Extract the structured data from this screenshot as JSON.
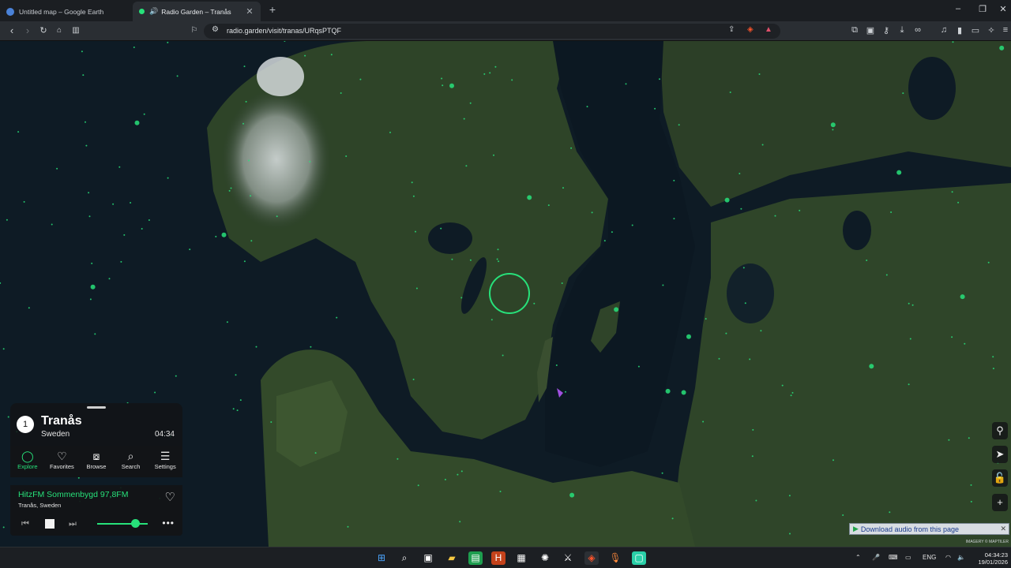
{
  "browser": {
    "tabs": [
      {
        "title": "Untitled map – Google Earth",
        "active": false
      },
      {
        "title": "Radio Garden – Tranås",
        "active": true
      }
    ],
    "url": "radio.garden/visit/tranas/URqsPTQF",
    "window_controls": [
      "minimize-icon",
      "maximize-icon",
      "close-icon"
    ]
  },
  "radio": {
    "location_count": "1",
    "place": "Tranås",
    "country": "Sweden",
    "local_time": "04:34",
    "nav": [
      {
        "label": "Explore",
        "icon": "explore-circle-icon",
        "active": true
      },
      {
        "label": "Favorites",
        "icon": "heart-icon",
        "active": false
      },
      {
        "label": "Browse",
        "icon": "map-icon",
        "active": false
      },
      {
        "label": "Search",
        "icon": "search-icon",
        "active": false
      },
      {
        "label": "Settings",
        "icon": "menu-icon",
        "active": false
      }
    ],
    "player": {
      "station": "HitzFM Sommenbygd 97,8FM",
      "station_location": "Tranås, Sweden",
      "volume": 0.8
    }
  },
  "map_controls": [
    "balloon-icon",
    "locate-icon",
    "lock-icon",
    "zoom-in-icon"
  ],
  "download_bar": {
    "label": "Download audio from this page"
  },
  "imagery_credit": "IMAGERY © MAPTILER",
  "taskbar": {
    "language": "ENG",
    "time": "04:34:23",
    "date": "19/01/2026"
  },
  "colors": {
    "accent": "#27e17a",
    "chrome": "#2a2e33"
  }
}
